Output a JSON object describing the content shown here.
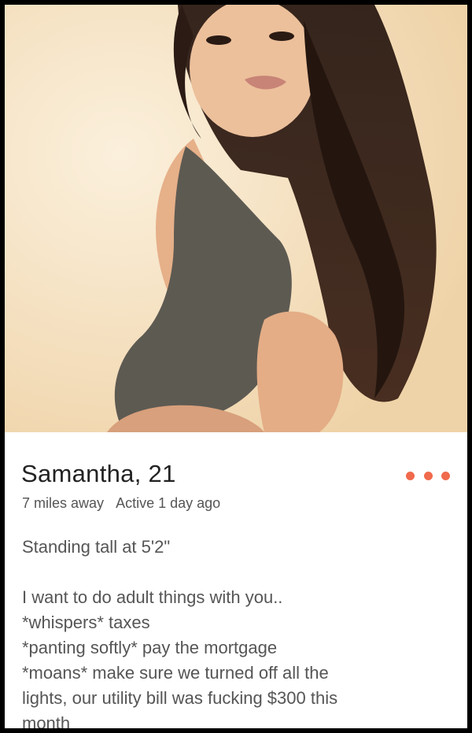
{
  "profile": {
    "name_age": "Samantha, 21",
    "distance": "7 miles away",
    "active": "Active 1 day ago",
    "bio_lines": [
      "Standing tall at 5'2\"",
      "I want to do adult things with you..",
      "*whispers* taxes",
      "*panting softly* pay the mortgage",
      "*moans* make sure we turned off all the",
      "lights, our utility bill was fucking $300 this",
      "month"
    ]
  },
  "colors": {
    "accent": "#f06a4c",
    "photo_background": "#f3dcb8",
    "text_primary": "#222222",
    "text_secondary": "#555555"
  },
  "icons": {
    "menu": "more-options-dots-icon"
  }
}
